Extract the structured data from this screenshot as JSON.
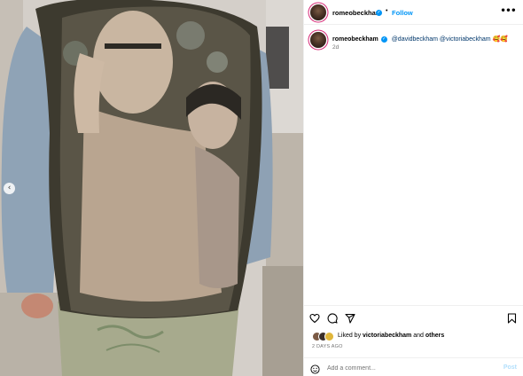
{
  "post": {
    "username": "romeobeckham",
    "follow_label": "Follow",
    "more_label": "•••",
    "verified_mark": "✓",
    "dot_separator": "•",
    "carousel_prev_icon": "‹"
  },
  "caption": {
    "username": "romeobeckham",
    "mention_1": "@davidbeckham",
    "mention_2": "@victoriabeckham",
    "emojis": "🥰🥰",
    "time": "2d"
  },
  "engagement": {
    "liked_by_prefix": "Liked by",
    "liked_by_user": "victoriabeckham",
    "and_label": "and",
    "others_label": "others",
    "time_ago": "2 DAYS AGO"
  },
  "comment": {
    "placeholder": "Add a comment...",
    "post_label": "Post"
  },
  "colors": {
    "accent_blue": "#0095f6",
    "mention_blue": "#00376b",
    "story_ring": "#d62976",
    "post_disabled": "#b2dffc"
  },
  "icons": [
    "chevron-left-icon",
    "verified-badge-icon",
    "more-icon",
    "heart-icon",
    "comment-icon",
    "share-icon",
    "bookmark-icon",
    "emoji-icon"
  ]
}
